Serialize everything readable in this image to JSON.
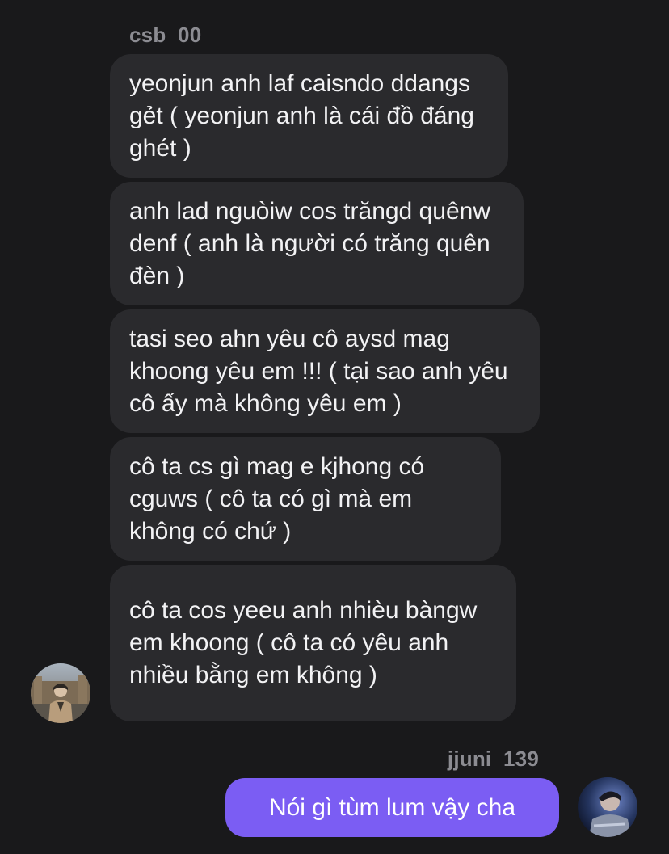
{
  "incoming": {
    "sender": "csb_00",
    "messages": [
      "yeonjun anh laf caisndo ddangs gẻt ( yeonjun anh là cái đồ đáng ghét )",
      "anh lad nguòiw cos trăngd quênw denf ( anh là người có trăng quên đèn )",
      "tasi seo ahn yêu cô aysd mag khoong yêu em !!! ( tại sao anh yêu cô ấy mà không yêu em )",
      "cô ta cs gì mag e kjhong có cguws ( cô ta có gì mà em không có chứ )",
      "cô ta cos yeeu anh nhièu bàngw em khoong ( cô ta có yêu anh nhiều bằng em không )"
    ]
  },
  "outgoing": {
    "sender": "jjuni_139",
    "message": "Nói gì tùm lum vậy cha",
    "bubble_color": "#7b5df3"
  },
  "theme": {
    "background": "#19191b",
    "incoming_bubble_color": "#2a2a2d"
  }
}
